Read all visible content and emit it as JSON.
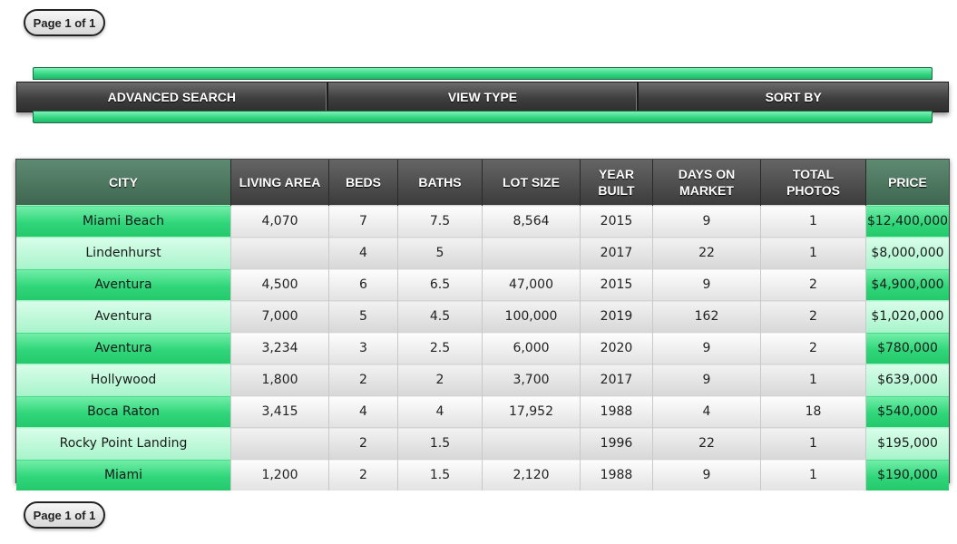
{
  "pagination": {
    "label": "Page 1 of 1"
  },
  "nav": {
    "items": [
      "ADVANCED SEARCH",
      "VIEW TYPE",
      "SORT BY"
    ]
  },
  "table": {
    "headers": [
      "CITY",
      "LIVING AREA",
      "BEDS",
      "BATHS",
      "LOT SIZE",
      "YEAR BUILT",
      "DAYS ON MARKET",
      "TOTAL PHOTOS",
      "PRICE"
    ],
    "rows": [
      [
        "Miami Beach",
        "4,070",
        "7",
        "7.5",
        "8,564",
        "2015",
        "9",
        "1",
        "$12,400,000"
      ],
      [
        "Lindenhurst",
        "",
        "4",
        "5",
        "",
        "2017",
        "22",
        "1",
        "$8,000,000"
      ],
      [
        "Aventura",
        "4,500",
        "6",
        "6.5",
        "47,000",
        "2015",
        "9",
        "2",
        "$4,900,000"
      ],
      [
        "Aventura",
        "7,000",
        "5",
        "4.5",
        "100,000",
        "2019",
        "162",
        "2",
        "$1,020,000"
      ],
      [
        "Aventura",
        "3,234",
        "3",
        "2.5",
        "6,000",
        "2020",
        "9",
        "2",
        "$780,000"
      ],
      [
        "Hollywood",
        "1,800",
        "2",
        "2",
        "3,700",
        "2017",
        "9",
        "1",
        "$639,000"
      ],
      [
        "Boca Raton",
        "3,415",
        "4",
        "4",
        "17,952",
        "1988",
        "4",
        "18",
        "$540,000"
      ],
      [
        "Rocky Point Landing",
        "",
        "2",
        "1.5",
        "",
        "1996",
        "22",
        "1",
        "$195,000"
      ],
      [
        "Miami",
        "1,200",
        "2",
        "1.5",
        "2,120",
        "1988",
        "9",
        "1",
        "$190,000"
      ]
    ]
  },
  "colors": {
    "accent_green": "#2fd679",
    "header_dark": "#3c3c3c",
    "header_green": "#4f7a60"
  }
}
